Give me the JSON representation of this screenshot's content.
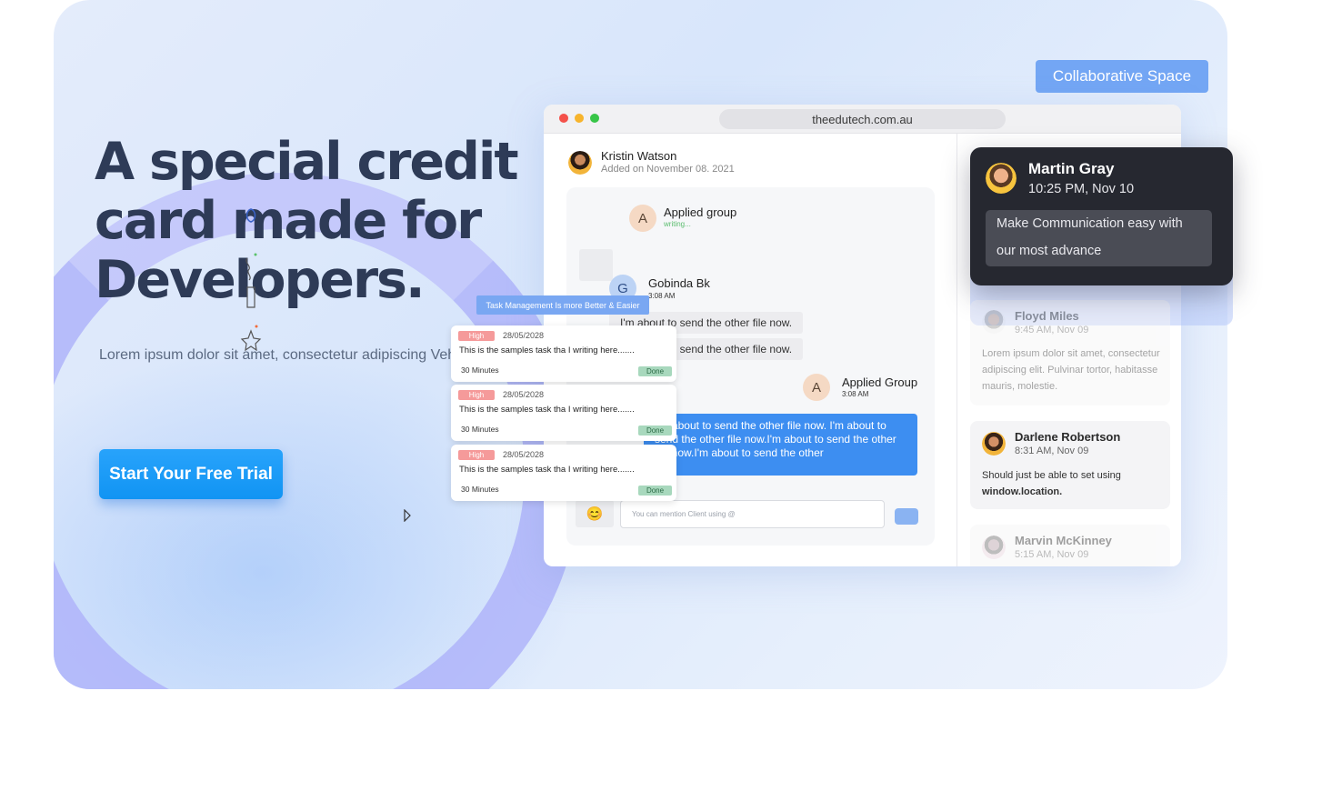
{
  "hero": {
    "headline": "A special credit card made for Developers.",
    "lead": "Lorem ipsum dolor sit amet, consectetur adipiscing Vehicula massa in enim luctus. Rutrum arcu.",
    "cta_label": "Start Your Free Trial"
  },
  "collab_badge": "Collaborative Space",
  "browser": {
    "url": "theedutech.com.au",
    "profile": {
      "name": "Kristin Watson",
      "added": "Added on November 08. 2021"
    },
    "chat": {
      "group1": {
        "letter": "A",
        "name": "Applied group",
        "status": "writing..."
      },
      "user2": {
        "letter": "G",
        "name": "Gobinda Bk",
        "time": "3:08 AM"
      },
      "messages_grey": [
        "I'm about to send the other file now.",
        "I'm about to send the other file now."
      ],
      "group2": {
        "letter": "A",
        "name": "Applied Group",
        "time": "3:08 AM"
      },
      "message_blue": "I'm about to send the other file now. I'm about to send the other file now.I'm about to send the other file now.I'm about to send the other",
      "emoji": "😊",
      "input_placeholder": "You can mention Client using @"
    }
  },
  "tasks": {
    "banner": "Task Management Is more Better & Easier",
    "items": [
      {
        "priority": "High",
        "date": "28/05/2028",
        "text": "This is the samples task tha I writing here.......",
        "duration": "30 Minutes",
        "status": "Done"
      },
      {
        "priority": "High",
        "date": "28/05/2028",
        "text": "This is the samples task tha I writing here.......",
        "duration": "30 Minutes",
        "status": "Done"
      },
      {
        "priority": "High",
        "date": "28/05/2028",
        "text": "This is the samples task tha I writing here.......",
        "duration": "30 Minutes",
        "status": "Done"
      }
    ]
  },
  "notifications": {
    "featured": {
      "name": "Martin Gray",
      "time": "10:25 PM, Nov 10",
      "message": "Make Communication easy with our most advance"
    },
    "list": [
      {
        "name": "Floyd Miles",
        "time": "9:45 AM, Nov 09",
        "body": "Lorem ipsum dolor sit amet, consectetur adipiscing elit. Pulvinar tortor, habitasse mauris, molestie."
      },
      {
        "name": "Darlene Robertson",
        "time": "8:31 AM, Nov 09",
        "body_prefix": "Should just be able to set using",
        "body_code": "window.location."
      },
      {
        "name": "Marvin McKinney",
        "time": "5:15 AM, Nov 09"
      }
    ]
  },
  "colors": {
    "brand_blue": "#1194f3",
    "headline": "#2e3b57",
    "chat_bubble": "#3d8ef1",
    "dark_card": "#262830"
  }
}
